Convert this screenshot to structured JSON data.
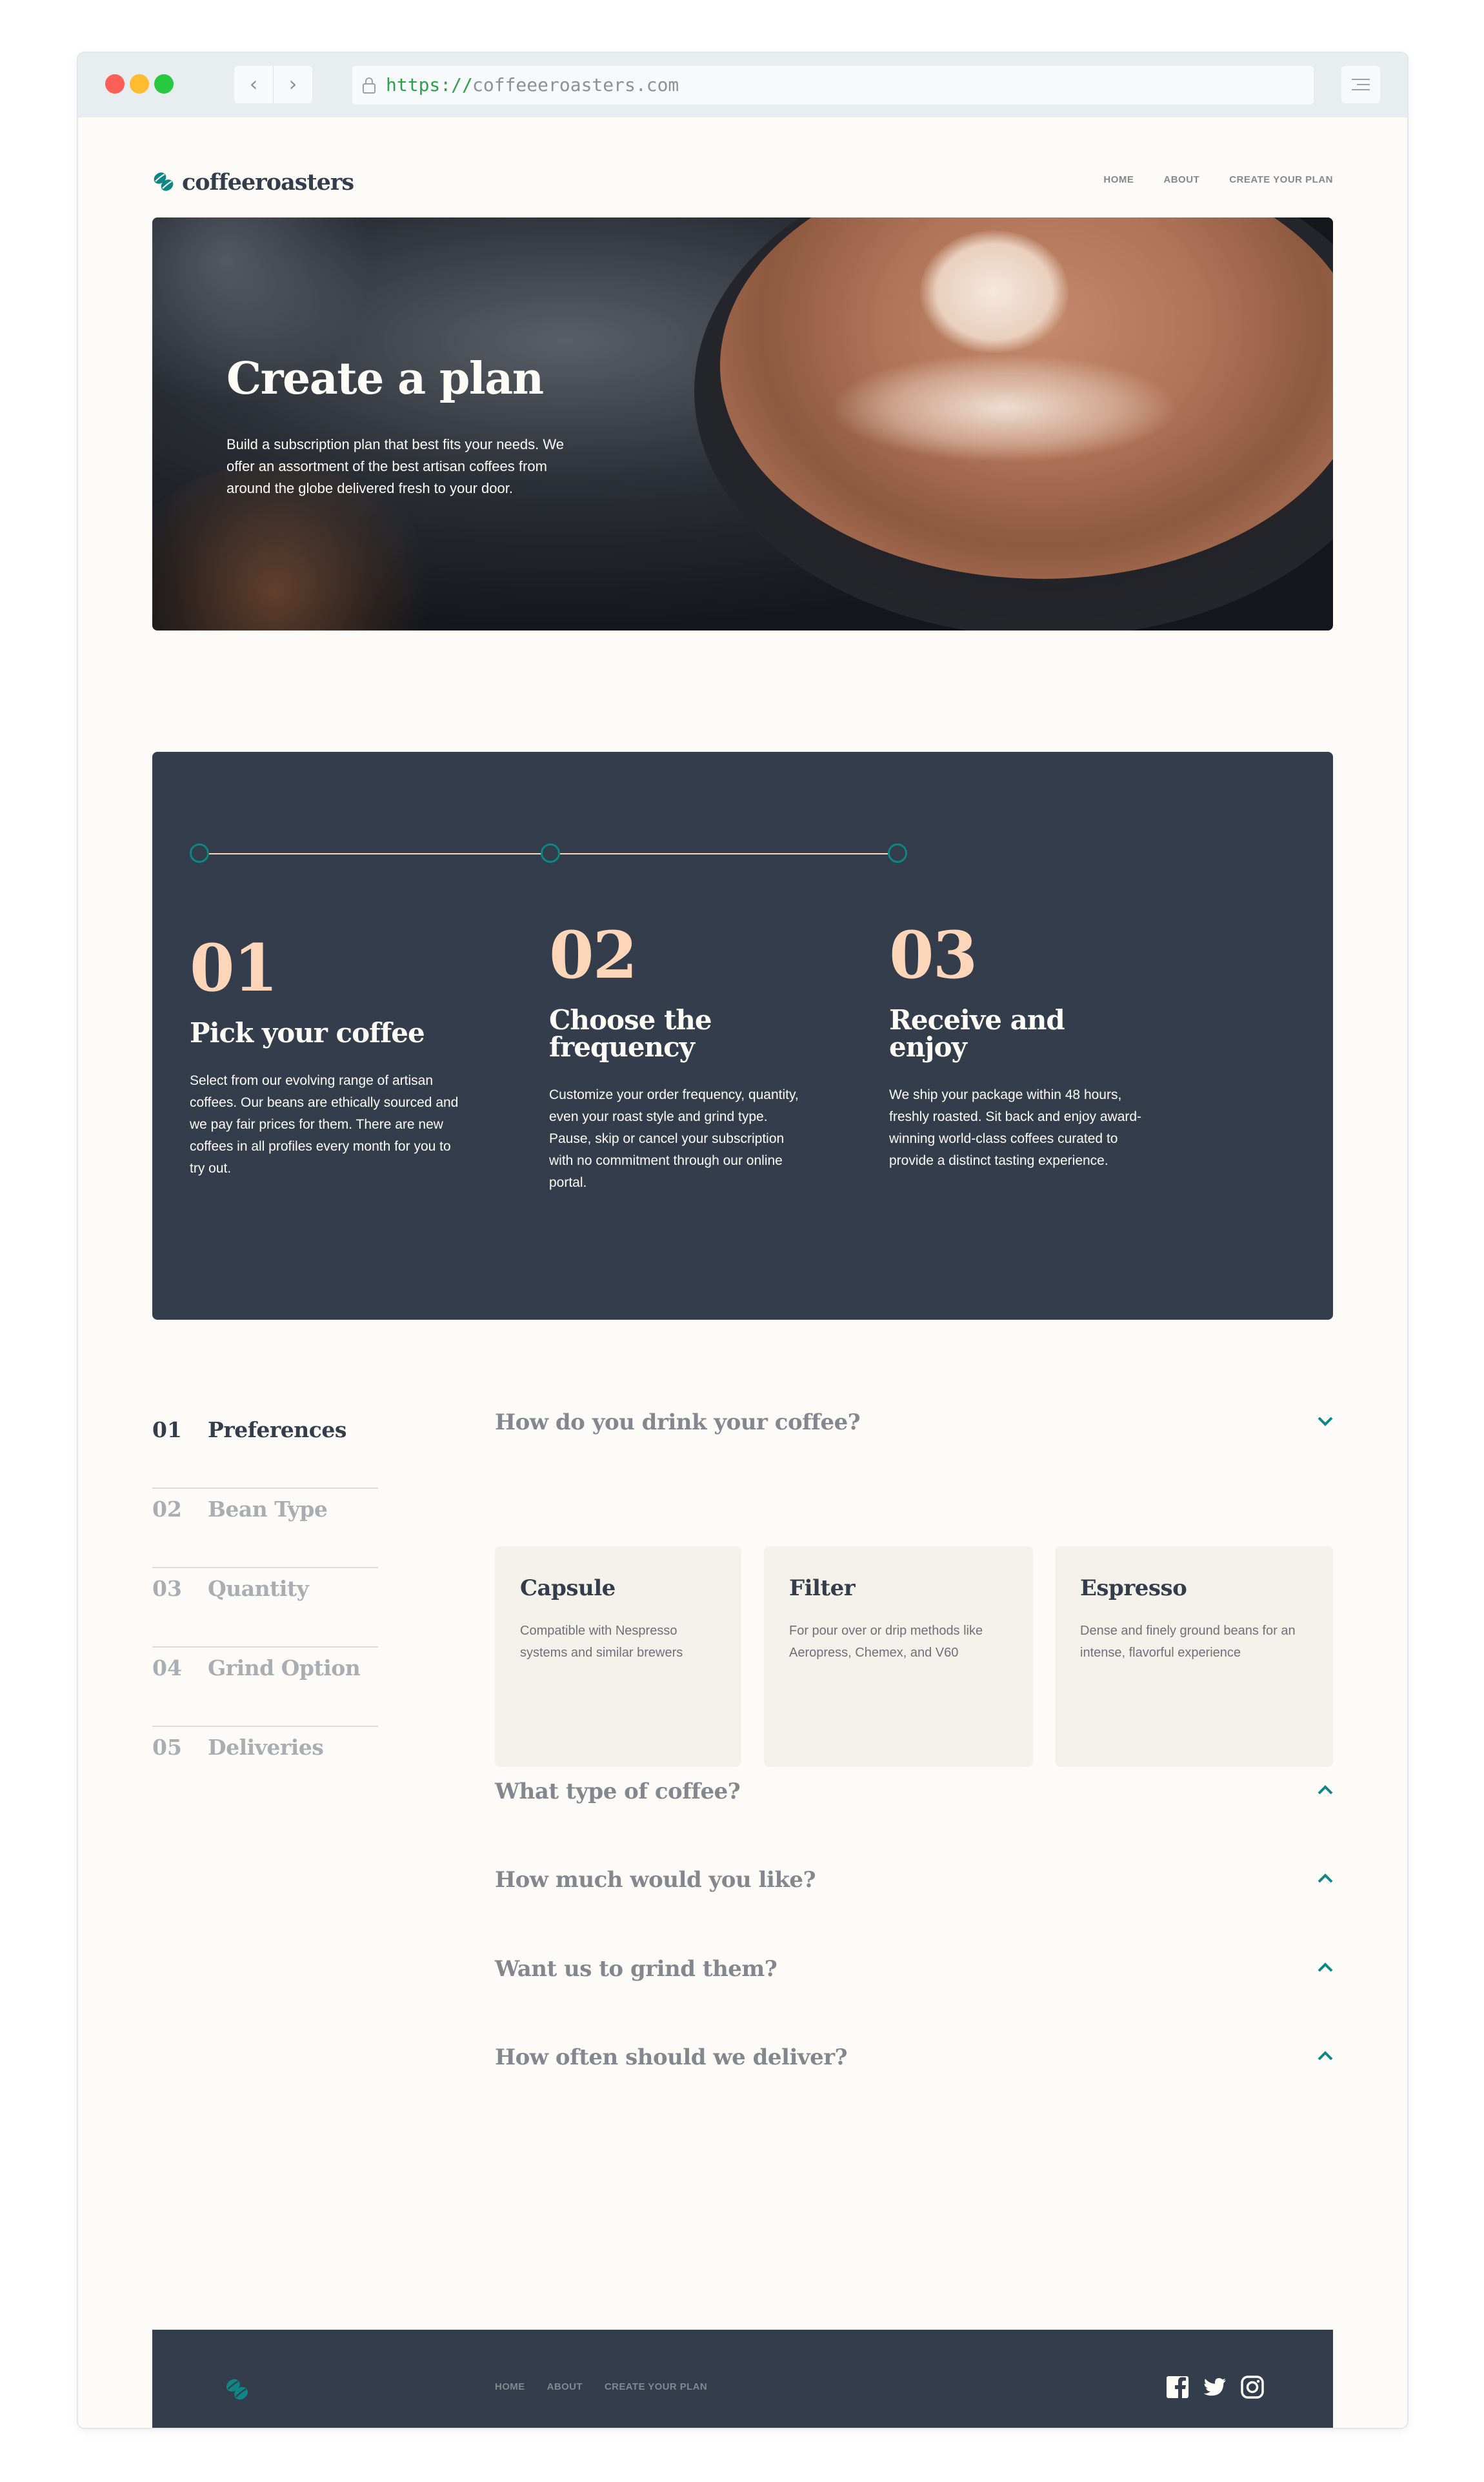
{
  "browser": {
    "url_scheme": "https://",
    "url_host": "coffeeeroasters.com",
    "back_icon": "chevron-left-icon",
    "forward_icon": "chevron-right-icon",
    "lock_icon": "lock-icon",
    "menu_icon": "sliders-icon"
  },
  "header": {
    "logo_text": "coffeeroasters",
    "nav": [
      "HOME",
      "ABOUT",
      "CREATE YOUR PLAN"
    ]
  },
  "hero": {
    "title": "Create a plan",
    "description": "Build a subscription plan that best fits your needs. We offer an assortment of the best artisan coffees from around the globe delivered fresh to your door."
  },
  "steps": [
    {
      "number": "01",
      "title": "Pick your coffee",
      "description": "Select from our evolving range of artisan coffees. Our beans are ethically sourced and we pay fair prices for them. There are new coffees in all profiles every month for you to try out."
    },
    {
      "number": "02",
      "title": "Choose the frequency",
      "description": "Customize your order frequency, quantity, even your roast style and grind type. Pause, skip or cancel your subscription with no commitment through our online portal."
    },
    {
      "number": "03",
      "title": "Receive and enjoy",
      "description": "We ship your package within 48 hours, freshly roasted. Sit back and enjoy award-winning world-class coffees curated to provide a distinct tasting experience."
    }
  ],
  "sidebar": {
    "items": [
      {
        "number": "01",
        "label": "Preferences"
      },
      {
        "number": "02",
        "label": "Bean Type"
      },
      {
        "number": "03",
        "label": "Quantity"
      },
      {
        "number": "04",
        "label": "Grind Option"
      },
      {
        "number": "05",
        "label": "Deliveries"
      }
    ]
  },
  "questions": [
    {
      "title": "How do you drink your coffee?",
      "state": "expanded"
    },
    {
      "title": "What type of coffee?",
      "state": "collapsed"
    },
    {
      "title": "How much would you like?",
      "state": "collapsed"
    },
    {
      "title": "Want us to grind them?",
      "state": "collapsed"
    },
    {
      "title": "How often should we deliver?",
      "state": "collapsed"
    }
  ],
  "options": [
    {
      "title": "Capsule",
      "description": "Compatible with Nespresso systems and similar brewers"
    },
    {
      "title": "Filter",
      "description": "For pour over or drip methods like Aeropress, Chemex, and V60"
    },
    {
      "title": "Espresso",
      "description": "Dense and finely ground beans for an intense, flavorful experience"
    }
  ],
  "footer": {
    "nav": [
      "HOME",
      "ABOUT",
      "CREATE YOUR PLAN"
    ],
    "social_icons": [
      "facebook-icon",
      "twitter-icon",
      "instagram-icon"
    ]
  },
  "colors": {
    "dark_blue": "#333d4b",
    "accent_teal": "#0e8784",
    "pale_orange": "#fdd6ba",
    "background": "#fdfbf7",
    "grey": "#83888f"
  }
}
